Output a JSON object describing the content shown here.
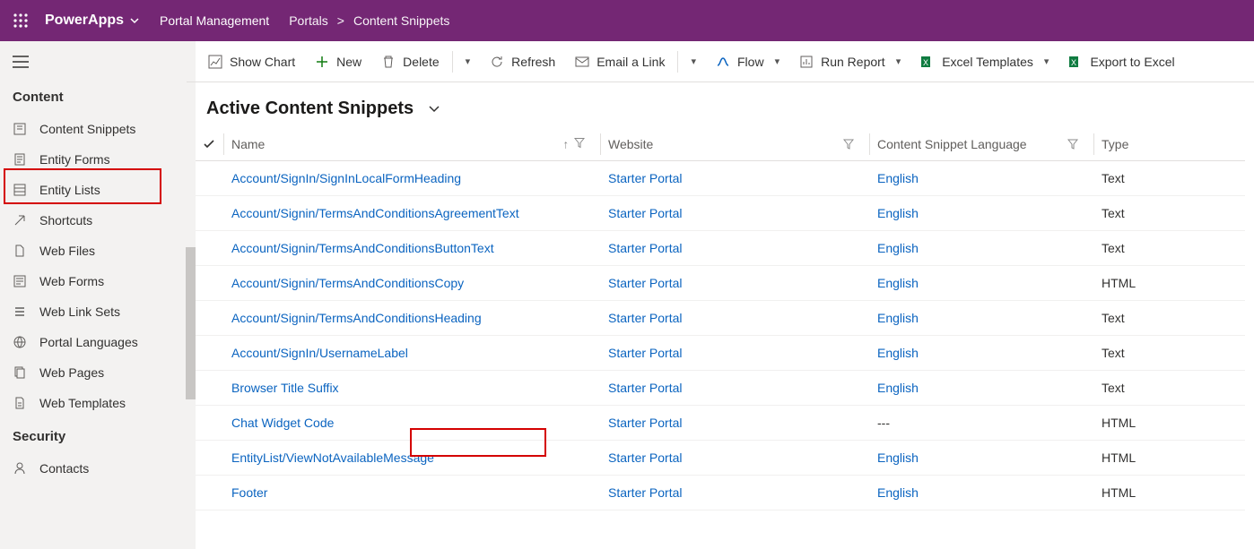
{
  "header": {
    "brand": "PowerApps",
    "environment": "Portal Management",
    "breadcrumb": [
      "Portals",
      "Content Snippets"
    ]
  },
  "sidebar": {
    "groups": [
      {
        "label": "Content",
        "items": [
          {
            "icon": "snippet",
            "label": "Content Snippets",
            "active": true
          },
          {
            "icon": "form",
            "label": "Entity Forms"
          },
          {
            "icon": "list",
            "label": "Entity Lists"
          },
          {
            "icon": "shortcut",
            "label": "Shortcuts"
          },
          {
            "icon": "file",
            "label": "Web Files"
          },
          {
            "icon": "webform",
            "label": "Web Forms"
          },
          {
            "icon": "linkset",
            "label": "Web Link Sets"
          },
          {
            "icon": "lang",
            "label": "Portal Languages"
          },
          {
            "icon": "pages",
            "label": "Web Pages"
          },
          {
            "icon": "template",
            "label": "Web Templates"
          }
        ]
      },
      {
        "label": "Security",
        "items": [
          {
            "icon": "contact",
            "label": "Contacts"
          }
        ]
      }
    ]
  },
  "commandbar": {
    "showChart": "Show Chart",
    "new": "New",
    "delete": "Delete",
    "refresh": "Refresh",
    "emailLink": "Email a Link",
    "flow": "Flow",
    "runReport": "Run Report",
    "excelTemplates": "Excel Templates",
    "exportExcel": "Export to Excel"
  },
  "view": {
    "title": "Active Content Snippets",
    "columns": [
      "Name",
      "Website",
      "Content Snippet Language",
      "Type"
    ],
    "rows": [
      {
        "name": "Account/SignIn/SignInLocalFormHeading",
        "site": "Starter Portal",
        "lang": "English",
        "type": "Text"
      },
      {
        "name": "Account/Signin/TermsAndConditionsAgreementText",
        "site": "Starter Portal",
        "lang": "English",
        "type": "Text"
      },
      {
        "name": "Account/Signin/TermsAndConditionsButtonText",
        "site": "Starter Portal",
        "lang": "English",
        "type": "Text"
      },
      {
        "name": "Account/Signin/TermsAndConditionsCopy",
        "site": "Starter Portal",
        "lang": "English",
        "type": "HTML"
      },
      {
        "name": "Account/Signin/TermsAndConditionsHeading",
        "site": "Starter Portal",
        "lang": "English",
        "type": "Text"
      },
      {
        "name": "Account/SignIn/UsernameLabel",
        "site": "Starter Portal",
        "lang": "English",
        "type": "Text"
      },
      {
        "name": "Browser Title Suffix",
        "site": "Starter Portal",
        "lang": "English",
        "type": "Text"
      },
      {
        "name": "Chat Widget Code",
        "site": "Starter Portal",
        "lang": "---",
        "langPlain": true,
        "type": "HTML"
      },
      {
        "name": "EntityList/ViewNotAvailableMessage",
        "site": "Starter Portal",
        "lang": "English",
        "type": "HTML"
      },
      {
        "name": "Footer",
        "site": "Starter Portal",
        "lang": "English",
        "type": "HTML"
      }
    ]
  }
}
